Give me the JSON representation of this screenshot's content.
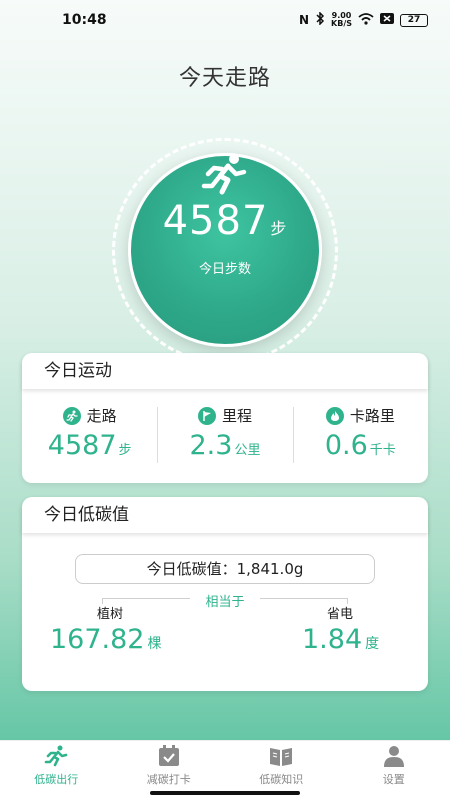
{
  "status_bar": {
    "time": "10:48",
    "nfc": "N",
    "speed_top": "9.00",
    "speed_bottom": "KB/S",
    "battery": "27"
  },
  "header": {
    "title": "今天走路"
  },
  "steps_ring": {
    "value": "4587",
    "unit": "步",
    "label": "今日步数"
  },
  "today_sport": {
    "title": "今日运动",
    "metrics": [
      {
        "icon": "runner-icon",
        "label": "走路",
        "value": "4587",
        "unit": "步"
      },
      {
        "icon": "flag-icon",
        "label": "里程",
        "value": "2.3",
        "unit": "公里"
      },
      {
        "icon": "fire-icon",
        "label": "卡路里",
        "value": "0.6",
        "unit": "千卡"
      }
    ]
  },
  "low_carbon": {
    "title": "今日低碳值",
    "summary": "今日低碳值：1,841.0g",
    "equivalent_label": "相当于",
    "tree": {
      "label": "植树",
      "value": "167.82",
      "unit": "棵"
    },
    "power": {
      "label": "省电",
      "value": "1.84",
      "unit": "度"
    }
  },
  "tabbar": {
    "tabs": [
      {
        "label": "低碳出行",
        "icon": "runner-icon",
        "active": true
      },
      {
        "label": "减碳打卡",
        "icon": "calendar-check-icon",
        "active": false
      },
      {
        "label": "低碳知识",
        "icon": "book-icon",
        "active": false
      },
      {
        "label": "设置",
        "icon": "user-icon",
        "active": false
      }
    ]
  },
  "colors": {
    "accent": "#2fb38d",
    "ring": "#2da788"
  }
}
